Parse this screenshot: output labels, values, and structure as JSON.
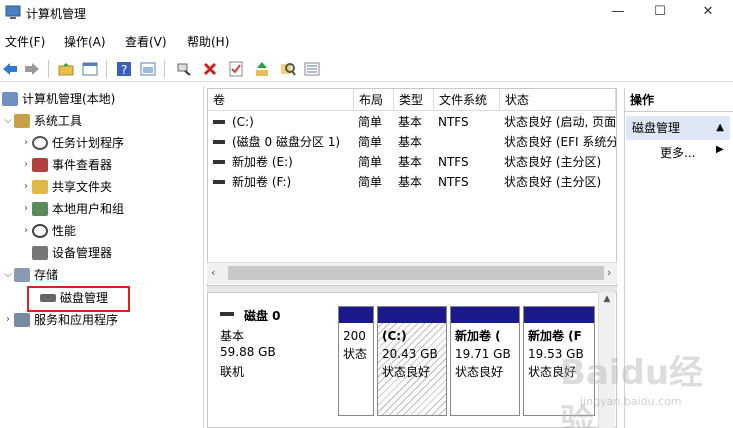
{
  "window": {
    "title": "计算机管理",
    "min_glyph": "—",
    "max_glyph": "☐",
    "close_glyph": "✕"
  },
  "menu": [
    "文件(F)",
    "操作(A)",
    "查看(V)",
    "帮助(H)"
  ],
  "tree": {
    "root": "计算机管理(本地)",
    "system_tools": "系统工具",
    "task_scheduler": "任务计划程序",
    "event_viewer": "事件查看器",
    "shared_folders": "共享文件夹",
    "local_users": "本地用户和组",
    "performance": "性能",
    "device_manager": "设备管理器",
    "storage": "存储",
    "disk_management": "磁盘管理",
    "services_apps": "服务和应用程序"
  },
  "volume_list": {
    "headers": [
      "卷",
      "布局",
      "类型",
      "文件系统",
      "状态"
    ],
    "rows": [
      [
        "(C:)",
        "简单",
        "基本",
        "NTFS",
        "状态良好 (启动, 页面"
      ],
      [
        "(磁盘 0 磁盘分区 1)",
        "简单",
        "基本",
        "",
        "状态良好 (EFI 系统分"
      ],
      [
        "新加卷 (E:)",
        "简单",
        "基本",
        "NTFS",
        "状态良好 (主分区)"
      ],
      [
        "新加卷 (F:)",
        "简单",
        "基本",
        "NTFS",
        "状态良好 (主分区)"
      ]
    ]
  },
  "disk": {
    "name": "磁盘 0",
    "type": "基本",
    "size": "59.88 GB",
    "status": "联机"
  },
  "partitions": [
    {
      "line1": "",
      "line2": "200",
      "line3": "状态"
    },
    {
      "line1": "(C:)",
      "line2": "20.43 GB",
      "line3": "状态良好"
    },
    {
      "line1": "新加卷 (",
      "line2": "19.71 GB",
      "line3": "状态良好"
    },
    {
      "line1": "新加卷 (F",
      "line2": "19.53 GB",
      "line3": "状态良好"
    }
  ],
  "actions": {
    "header": "操作",
    "section": "磁盘管理",
    "more": "更多..."
  },
  "watermark": {
    "brand": "Baidu经验",
    "url": "jingyan.baidu.com"
  }
}
